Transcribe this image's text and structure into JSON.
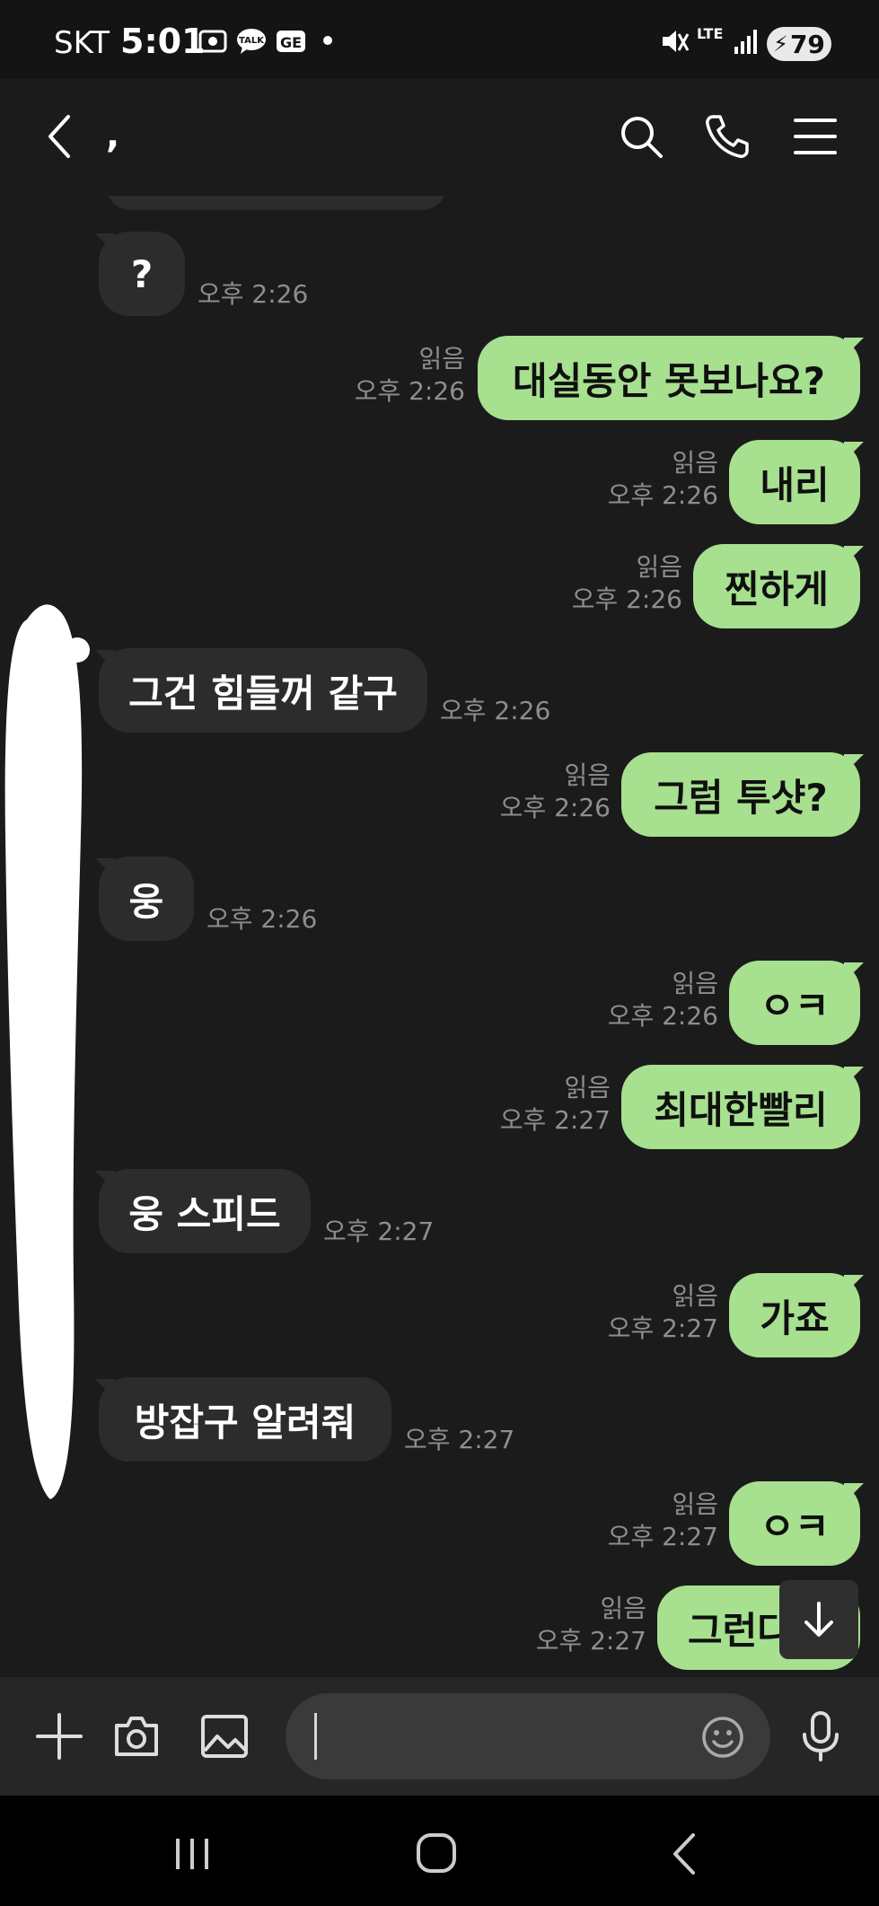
{
  "status_bar": {
    "carrier": "SKT",
    "time": "5:01",
    "network": "LTE",
    "battery": "79"
  },
  "header": {
    "title": ","
  },
  "messages": [
    {
      "side": "in",
      "text": "?",
      "time": "오후 2:26"
    },
    {
      "side": "out",
      "text": "대실동안 못보나요?",
      "read": "읽음",
      "time": "오후 2:26"
    },
    {
      "side": "out",
      "text": "내리",
      "read": "읽음",
      "time": "오후 2:26"
    },
    {
      "side": "out",
      "text": "찐하게",
      "read": "읽음",
      "time": "오후 2:26"
    },
    {
      "side": "in",
      "text": "그건 힘들꺼 같구",
      "time": "오후 2:26"
    },
    {
      "side": "out",
      "text": "그럼 투샷?",
      "read": "읽음",
      "time": "오후 2:26"
    },
    {
      "side": "in",
      "text": "웅",
      "time": "오후 2:26"
    },
    {
      "side": "out",
      "text": "ㅇㅋ",
      "read": "읽음",
      "time": "오후 2:26"
    },
    {
      "side": "out",
      "text": "최대한빨리",
      "read": "읽음",
      "time": "오후 2:27"
    },
    {
      "side": "in",
      "text": "웅 스피드",
      "time": "오후 2:27"
    },
    {
      "side": "out",
      "text": "가죠",
      "read": "읽음",
      "time": "오후 2:27"
    },
    {
      "side": "in",
      "text": "방잡구 알려줘",
      "time": "오후 2:27"
    },
    {
      "side": "out",
      "text": "ㅇㅋ",
      "read": "읽음",
      "time": "오후 2:27"
    },
    {
      "side": "out",
      "text": "그런다",
      "read": "읽음",
      "time": "오후 2:27"
    }
  ],
  "colors": {
    "background": "#1b1b1b",
    "bubble_in": "#2c2c2c",
    "bubble_out": "#a7e08f",
    "meta_text": "#8e8e8e"
  },
  "icons": [
    "back-icon",
    "search-icon",
    "phone-icon",
    "menu-icon",
    "plus-icon",
    "camera-icon",
    "gallery-icon",
    "emoji-icon",
    "mic-icon",
    "scroll-down-icon",
    "recents-icon",
    "home-icon",
    "nav-back-icon"
  ]
}
